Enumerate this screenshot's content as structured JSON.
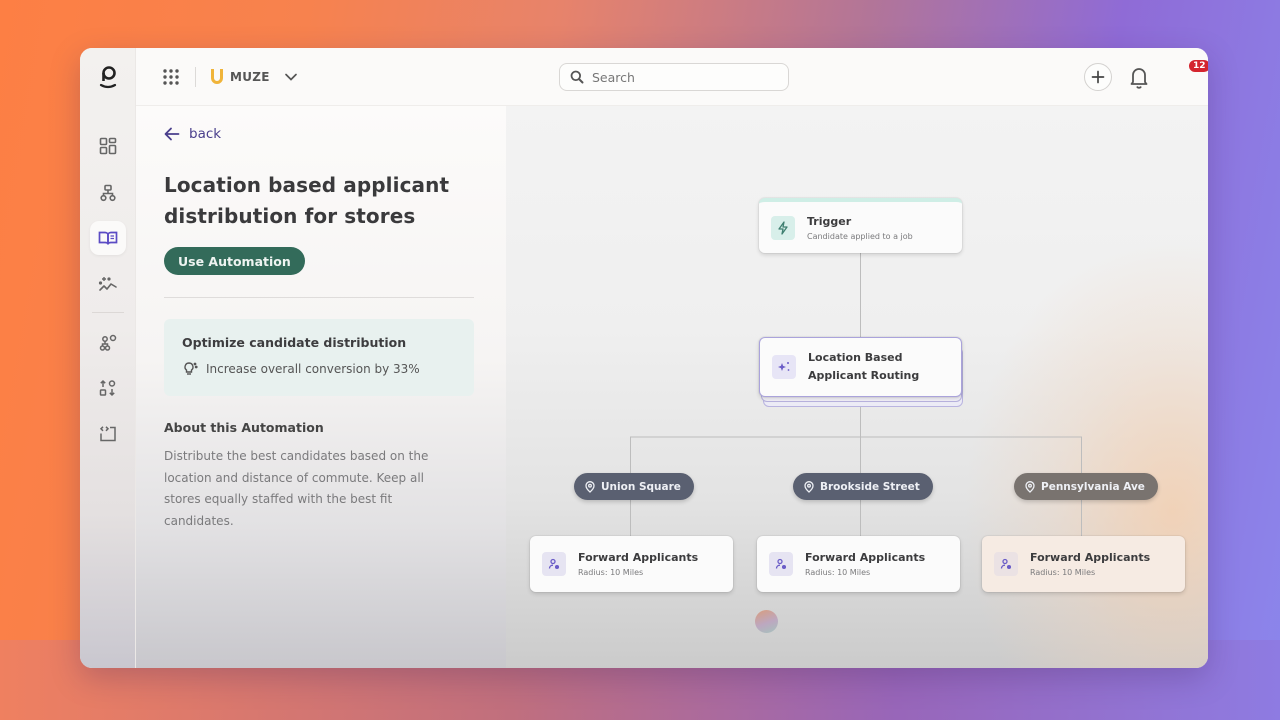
{
  "topbar": {
    "org_name": "MUZE",
    "search_placeholder": "Search",
    "notification_count": "12"
  },
  "sidebar": {
    "items": [
      {
        "name": "dashboard",
        "icon": "grid-icon",
        "active": false
      },
      {
        "name": "workflows",
        "icon": "hierarchy-icon",
        "active": false
      },
      {
        "name": "library",
        "icon": "book-open-icon",
        "active": true
      },
      {
        "name": "insights",
        "icon": "sparkle-chart-icon",
        "active": false
      },
      {
        "name": "integrations",
        "icon": "network-settings-icon",
        "active": false
      },
      {
        "name": "sort",
        "icon": "sort-shapes-icon",
        "active": false
      },
      {
        "name": "embed",
        "icon": "code-frame-icon",
        "active": false
      }
    ]
  },
  "detail": {
    "back_label": "back",
    "title": "Location based applicant distribution for stores",
    "use_button": "Use Automation",
    "insight": {
      "title": "Optimize candidate distribution",
      "text": "Increase overall conversion by 33%"
    },
    "about_title": "About this Automation",
    "about_text": "Distribute the best candidates based on the location and distance of commute. Keep all stores equally staffed with the best fit candidates."
  },
  "flow": {
    "trigger": {
      "title": "Trigger",
      "subtitle": "Candidate applied to a job"
    },
    "routing": {
      "title": "Location Based Applicant Routing"
    },
    "branches": [
      {
        "location": "Union Square",
        "action_title": "Forward Applicants",
        "action_subtitle": "Radius: 10 Miles"
      },
      {
        "location": "Brookside Street",
        "action_title": "Forward Applicants",
        "action_subtitle": "Radius: 10 Miles"
      },
      {
        "location": "Pennsylvania Ave",
        "action_title": "Forward Applicants",
        "action_subtitle": "Radius: 10 Miles"
      }
    ]
  },
  "colors": {
    "primary_button": "#336b5a",
    "back_link": "#4a3f8c",
    "badge": "#d4252f",
    "location_pill": "#5a6071",
    "accent_purple": "#6a5cc7"
  }
}
